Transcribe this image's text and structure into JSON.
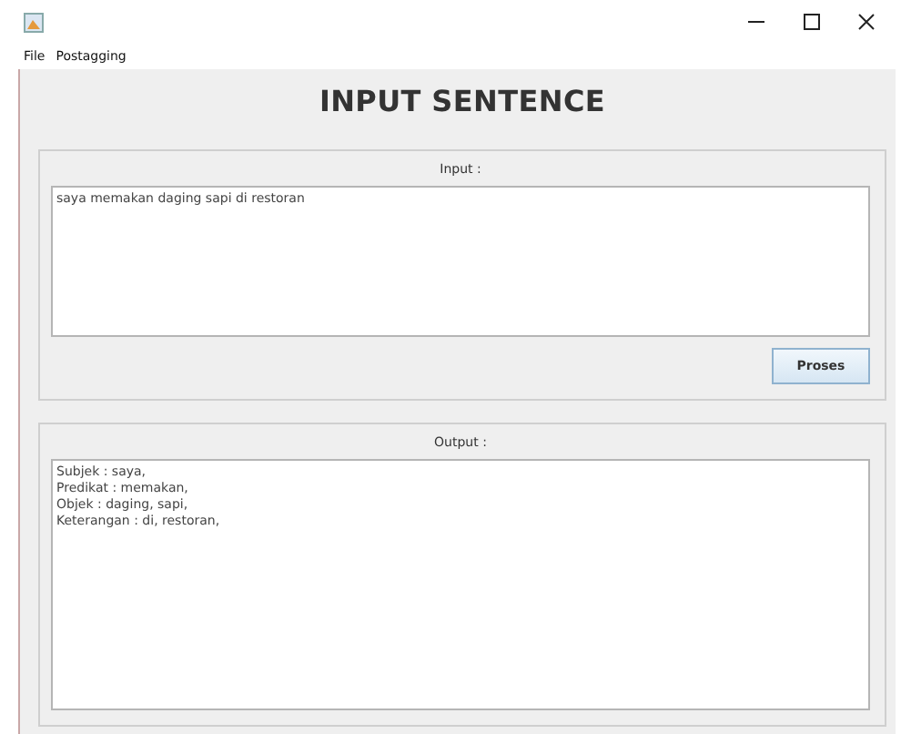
{
  "menu": [
    "File",
    "Postagging"
  ],
  "heading": "INPUT SENTENCE",
  "input_panel": {
    "label": "Input :",
    "value": "saya memakan daging sapi di restoran",
    "button": "Proses"
  },
  "output_panel": {
    "label": "Output :",
    "lines": [
      "Subjek : saya,",
      "Predikat : memakan,",
      "Objek : daging, sapi,",
      "Keterangan : di, restoran,"
    ]
  }
}
